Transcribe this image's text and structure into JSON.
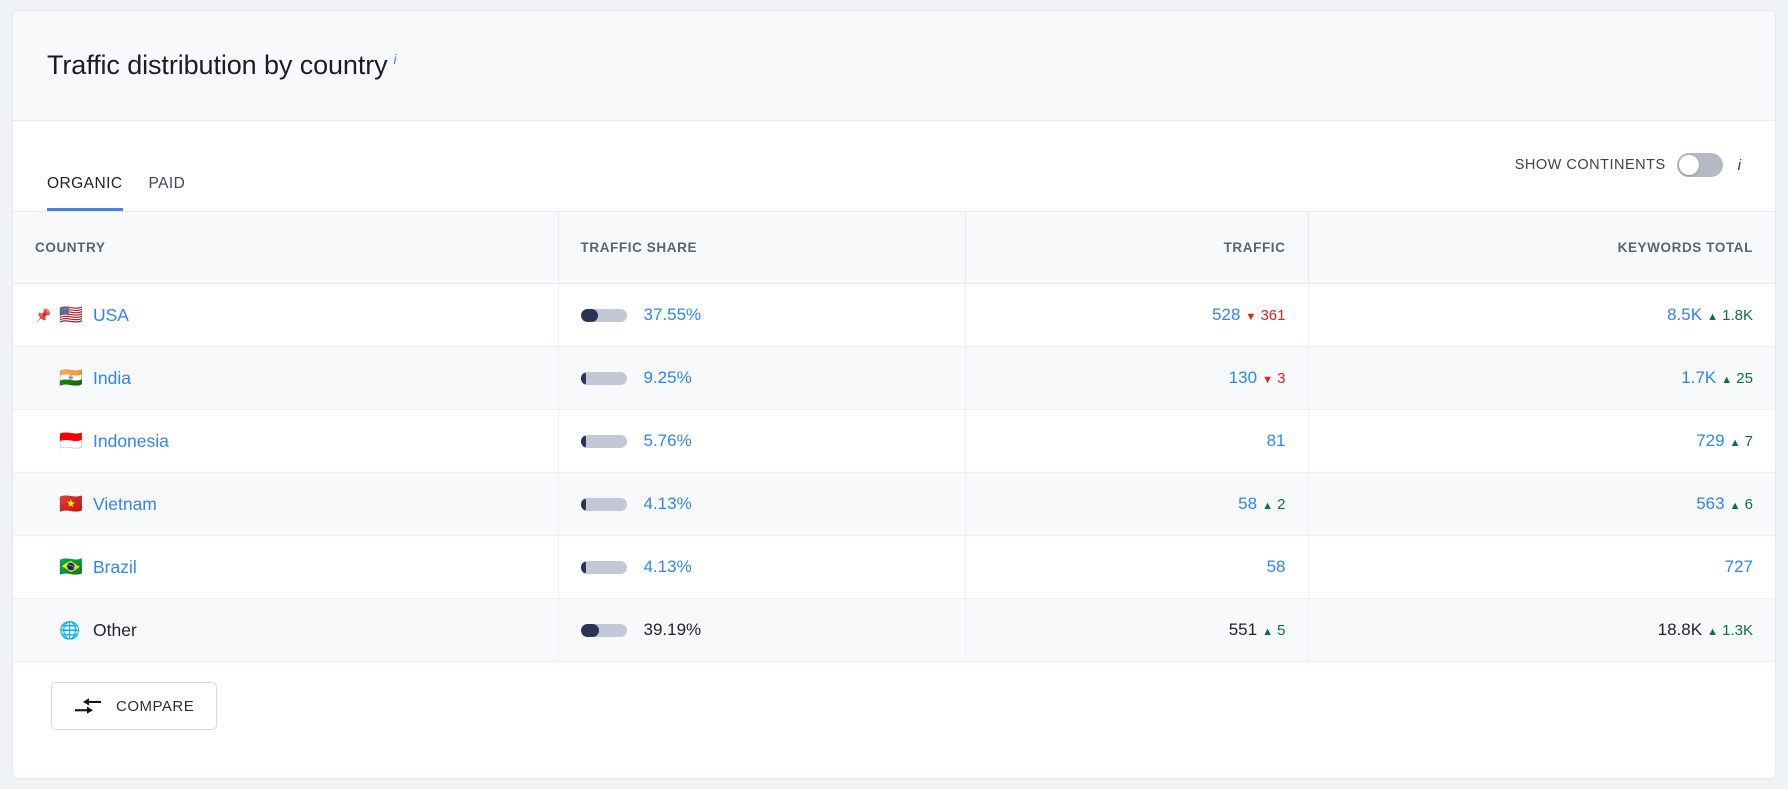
{
  "header": {
    "title": "Traffic distribution by country",
    "info_icon": "info-icon",
    "info_glyph": "i"
  },
  "tabs": [
    {
      "id": "organic",
      "label": "ORGANIC",
      "active": true
    },
    {
      "id": "paid",
      "label": "PAID",
      "active": false
    }
  ],
  "toggle": {
    "label": "SHOW CONTINENTS",
    "state": "off",
    "info_glyph": "i"
  },
  "table": {
    "columns": [
      {
        "key": "country",
        "label": "COUNTRY"
      },
      {
        "key": "share",
        "label": "TRAFFIC SHARE"
      },
      {
        "key": "traffic",
        "label": "TRAFFIC"
      },
      {
        "key": "keywords",
        "label": "KEYWORDS TOTAL"
      }
    ],
    "rows": [
      {
        "pinned": true,
        "flag": "🇺🇸",
        "country": "USA",
        "share_pct": "37.55%",
        "share_value": 37.55,
        "traffic": "528",
        "traffic_delta": "361",
        "traffic_delta_dir": "down",
        "keywords": "8.5K",
        "keywords_delta": "1.8K",
        "keywords_delta_dir": "up"
      },
      {
        "pinned": false,
        "flag": "🇮🇳",
        "country": "India",
        "share_pct": "9.25%",
        "share_value": 9.25,
        "traffic": "130",
        "traffic_delta": "3",
        "traffic_delta_dir": "down",
        "keywords": "1.7K",
        "keywords_delta": "25",
        "keywords_delta_dir": "up"
      },
      {
        "pinned": false,
        "flag": "🇮🇩",
        "country": "Indonesia",
        "share_pct": "5.76%",
        "share_value": 5.76,
        "traffic": "81",
        "traffic_delta": "",
        "traffic_delta_dir": "",
        "keywords": "729",
        "keywords_delta": "7",
        "keywords_delta_dir": "up"
      },
      {
        "pinned": false,
        "flag": "🇻🇳",
        "country": "Vietnam",
        "share_pct": "4.13%",
        "share_value": 4.13,
        "traffic": "58",
        "traffic_delta": "2",
        "traffic_delta_dir": "up",
        "keywords": "563",
        "keywords_delta": "6",
        "keywords_delta_dir": "up"
      },
      {
        "pinned": false,
        "flag": "🇧🇷",
        "country": "Brazil",
        "share_pct": "4.13%",
        "share_value": 4.13,
        "traffic": "58",
        "traffic_delta": "",
        "traffic_delta_dir": "",
        "keywords": "727",
        "keywords_delta": "",
        "keywords_delta_dir": ""
      },
      {
        "pinned": false,
        "flag": "🌐",
        "is_other": true,
        "country": "Other",
        "share_pct": "39.19%",
        "share_value": 39.19,
        "traffic": "551",
        "traffic_delta": "5",
        "traffic_delta_dir": "up",
        "keywords": "18.8K",
        "keywords_delta": "1.3K",
        "keywords_delta_dir": "up"
      }
    ]
  },
  "footer": {
    "compare_label": "COMPARE",
    "compare_icon": "compare-arrows-icon"
  },
  "colors": {
    "link": "#2f86ec",
    "accent": "#4b7bec",
    "bar_fill": "#2c3456",
    "bar_track": "#c2c8d6",
    "delta_up": "#0e6e45",
    "delta_down": "#e02020",
    "header_bg": "#f8f9fb"
  }
}
